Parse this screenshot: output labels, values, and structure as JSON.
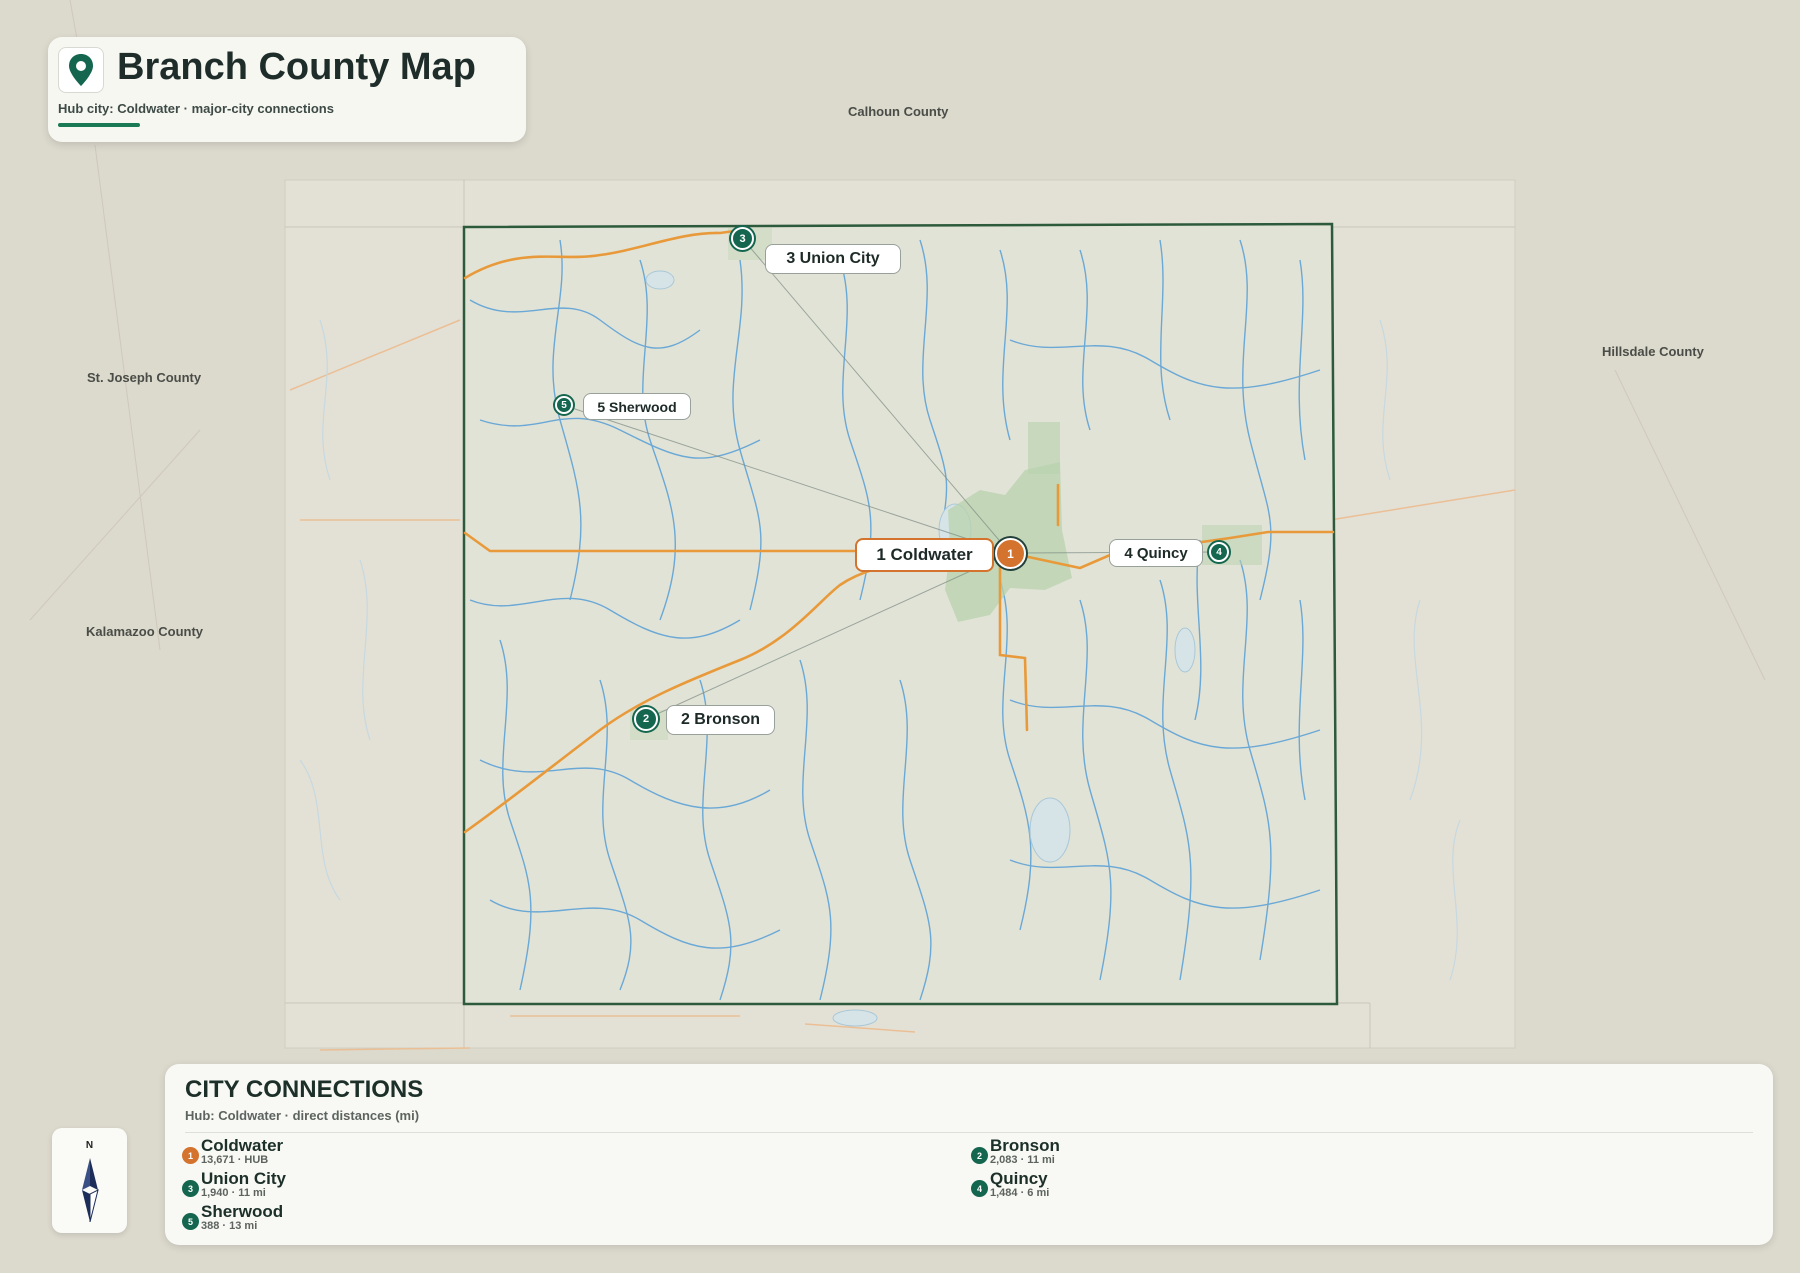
{
  "header": {
    "title": "Branch County Map",
    "subtitle": "Hub city: Coldwater · major-city connections"
  },
  "neighbors": [
    {
      "name": "Calhoun County"
    },
    {
      "name": "St. Joseph County"
    },
    {
      "name": "Kalamazoo County"
    },
    {
      "name": "Hillsdale County"
    }
  ],
  "cities": [
    {
      "num": "1",
      "name": "Coldwater",
      "label": "1 Coldwater",
      "population": "13,671",
      "detail": "13,671 · HUB",
      "hub": true
    },
    {
      "num": "2",
      "name": "Bronson",
      "label": "2 Bronson",
      "population": "2,083",
      "distance_mi": 11,
      "detail": "2,083 · 11 mi",
      "hub": false
    },
    {
      "num": "3",
      "name": "Union City",
      "label": "3 Union City",
      "population": "1,940",
      "distance_mi": 11,
      "detail": "1,940 · 11 mi",
      "hub": false
    },
    {
      "num": "4",
      "name": "Quincy",
      "label": "4 Quincy",
      "population": "1,484",
      "distance_mi": 6,
      "detail": "1,484 · 6 mi",
      "hub": false
    },
    {
      "num": "5",
      "name": "Sherwood",
      "label": "5 Sherwood",
      "population": "388",
      "distance_mi": 13,
      "detail": "388 · 13 mi",
      "hub": false
    }
  ],
  "panel": {
    "title": "CITY CONNECTIONS",
    "subtitle": "Hub: Coldwater · direct distances (mi)"
  },
  "compass": {
    "north_label": "N"
  },
  "colors": {
    "hub": "#d3732e",
    "city": "#15664f",
    "county_border": "#2c5a3b",
    "roads": "#e89a3a",
    "rivers": "#6aa8d6",
    "urban": "#b8d3ae"
  },
  "icons": {
    "title_icon": "map-pin-icon",
    "compass_icon": "north-arrow-icon"
  }
}
